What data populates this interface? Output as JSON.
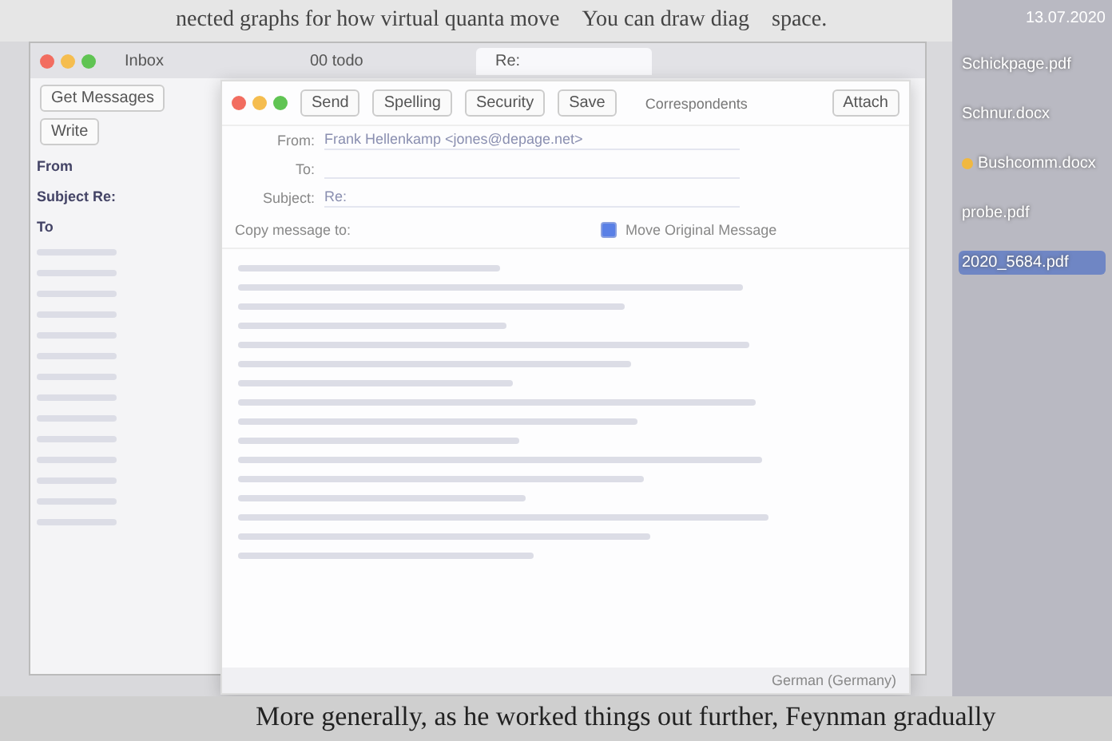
{
  "book_text": {
    "top_line": "nected graphs for how virtual quanta move",
    "top_line_2": "You can draw diag",
    "top_line_3": "space.",
    "bottom_line": "More generally, as he worked things out further, Feynman gradually"
  },
  "mail_window": {
    "tabs": [
      {
        "label": "Inbox",
        "selected": false
      },
      {
        "label": "00 todo",
        "selected": false
      },
      {
        "label": "Re:",
        "selected": true
      }
    ],
    "toolbar": [
      "Get Messages",
      "Write"
    ],
    "message_list": [
      "From",
      "Subject Re:",
      "To"
    ],
    "column_header": "Correspondents"
  },
  "compose_window": {
    "toolbar": [
      "Send",
      "Spelling",
      "Security",
      "Save"
    ],
    "attach_button": "Attach",
    "fields": [
      {
        "label": "From:",
        "value": "Frank Hellenkamp <jones@depage.net>"
      },
      {
        "label": "To:"
      },
      {
        "label": "Subject:",
        "value": "Re:"
      }
    ],
    "copy_label": "Copy message to:",
    "move_original": {
      "label": "Move Original Message",
      "checked": true
    },
    "language": "German (Germany)"
  },
  "desktop": {
    "date": "13.07.2020",
    "files": [
      {
        "name": "Schickpage.pdf",
        "selected": false
      },
      {
        "name": "Schnur.docx",
        "selected": false
      },
      {
        "name": "Bushcomm.docx",
        "selected": false,
        "color": "#f0b840"
      },
      {
        "name": "probe.pdf",
        "selected": false
      },
      {
        "name": "2020_5684.pdf",
        "selected": true
      }
    ]
  }
}
